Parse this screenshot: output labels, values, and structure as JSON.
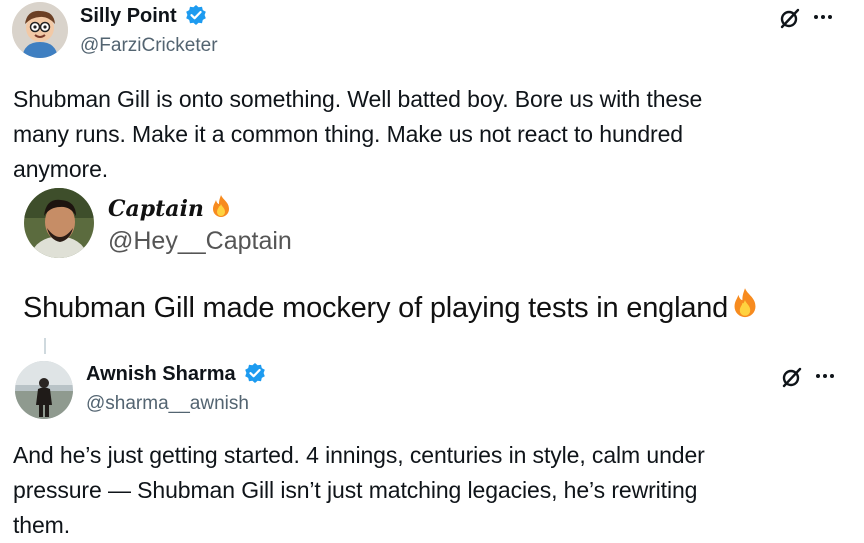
{
  "tweet1": {
    "name": "Silly Point",
    "handle": "@FarziCricketer",
    "text_lines": [
      "Shubman Gill is onto something. Well batted boy. Bore us with these",
      "many runs. Make it a common thing. Make us not react to hundred",
      "anymore."
    ],
    "verified": true,
    "icons": [
      "grok-icon",
      "more-icon"
    ]
  },
  "quoted": {
    "name": "Captain",
    "handle": "@Hey__Captain",
    "text": "Shubman Gill made mockery of playing tests in england",
    "emoji": "fire-icon"
  },
  "tweet2": {
    "name": "Awnish Sharma",
    "handle": "@sharma__awnish",
    "text_lines": [
      "And he’s just getting started. 4 innings, centuries in style, calm under",
      "pressure — Shubman Gill isn’t just matching legacies, he’s rewriting",
      "them."
    ],
    "verified": true,
    "icons": [
      "grok-icon",
      "more-icon"
    ]
  },
  "colors": {
    "verified": "#1d9bf0",
    "text": "#0f1419",
    "secondary": "#536471",
    "thread_line": "#cfd9de"
  }
}
